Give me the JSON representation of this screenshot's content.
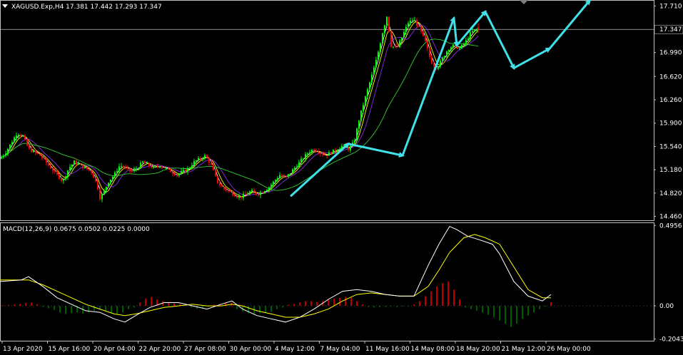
{
  "header": {
    "symbol_line": "XAGUSD.Exp,H4  17.381 17.442 17.293 17.347",
    "macd_line": "MACD(12,26,9) 0.0675 0.0502 0.0225 0.0000"
  },
  "colors": {
    "background": "#000000",
    "frame": "#c0c0c0",
    "bull": "#00ff00",
    "bear": "#ff0000",
    "ma_fast": "#ffff00",
    "ma_mid": "#ffffff",
    "ma_slow": "#8a2be2",
    "ma_long": "#32cd32",
    "arrows": "#40e0e8",
    "macd_line": "#ffffff",
    "signal_line": "#ffff00",
    "hist_up": "#ff0000",
    "hist_down": "#008000"
  },
  "chart_data": [
    {
      "type": "candlestick",
      "panel": "price",
      "symbol": "XAGUSD.Exp",
      "timeframe": "H4",
      "ohlc_last": {
        "open": 17.381,
        "high": 17.442,
        "low": 17.293,
        "close": 17.347
      },
      "current_price_label": "17.347",
      "current_price": 17.347,
      "ylim": [
        14.4,
        17.79
      ],
      "y_ticks": [
        "17.710",
        "16.990",
        "16.620",
        "16.260",
        "15.900",
        "15.540",
        "15.180",
        "14.820",
        "14.460"
      ],
      "y_tick_values": [
        17.71,
        16.99,
        16.62,
        16.26,
        15.9,
        15.54,
        15.18,
        14.82,
        14.46
      ],
      "x_ticks": [
        "13 Apr 2020",
        "15 Apr 16:00",
        "20 Apr 04:00",
        "22 Apr 20:00",
        "27 Apr 08:00",
        "30 Apr 00:00",
        "4 May 12:00",
        "7 May 04:00",
        "11 May 16:00",
        "14 May 08:00",
        "18 May 20:00",
        "21 May 12:00",
        "26 May 00:00"
      ],
      "close_path": [
        [
          0,
          15.35
        ],
        [
          8,
          15.45
        ],
        [
          16,
          15.6
        ],
        [
          24,
          15.75
        ],
        [
          32,
          15.7
        ],
        [
          40,
          15.5
        ],
        [
          48,
          15.45
        ],
        [
          56,
          15.4
        ],
        [
          64,
          15.3
        ],
        [
          72,
          15.2
        ],
        [
          80,
          15.1
        ],
        [
          88,
          15.0
        ],
        [
          96,
          15.2
        ],
        [
          104,
          15.3
        ],
        [
          112,
          15.25
        ],
        [
          120,
          15.2
        ],
        [
          128,
          15.15
        ],
        [
          136,
          14.95
        ],
        [
          140,
          14.75
        ],
        [
          144,
          14.8
        ],
        [
          152,
          15.0
        ],
        [
          160,
          15.1
        ],
        [
          168,
          15.25
        ],
        [
          176,
          15.2
        ],
        [
          184,
          15.15
        ],
        [
          192,
          15.2
        ],
        [
          200,
          15.3
        ],
        [
          208,
          15.25
        ],
        [
          216,
          15.2
        ],
        [
          224,
          15.25
        ],
        [
          232,
          15.2
        ],
        [
          240,
          15.15
        ],
        [
          248,
          15.1
        ],
        [
          256,
          15.15
        ],
        [
          264,
          15.2
        ],
        [
          272,
          15.3
        ],
        [
          280,
          15.35
        ],
        [
          288,
          15.4
        ],
        [
          296,
          15.25
        ],
        [
          304,
          15.0
        ],
        [
          312,
          14.9
        ],
        [
          320,
          14.85
        ],
        [
          328,
          14.8
        ],
        [
          336,
          14.75
        ],
        [
          344,
          14.8
        ],
        [
          352,
          14.85
        ],
        [
          360,
          14.8
        ],
        [
          368,
          14.85
        ],
        [
          376,
          14.9
        ],
        [
          384,
          15.0
        ],
        [
          392,
          15.1
        ],
        [
          400,
          15.05
        ],
        [
          408,
          15.15
        ],
        [
          416,
          15.25
        ],
        [
          424,
          15.35
        ],
        [
          432,
          15.45
        ],
        [
          440,
          15.5
        ],
        [
          448,
          15.45
        ],
        [
          456,
          15.4
        ],
        [
          464,
          15.45
        ],
        [
          472,
          15.5
        ],
        [
          480,
          15.55
        ],
        [
          488,
          15.5
        ],
        [
          496,
          15.6
        ],
        [
          504,
          16.0
        ],
        [
          512,
          16.3
        ],
        [
          520,
          16.6
        ],
        [
          528,
          16.9
        ],
        [
          536,
          17.3
        ],
        [
          542,
          17.55
        ],
        [
          548,
          17.1
        ],
        [
          556,
          17.05
        ],
        [
          564,
          17.25
        ],
        [
          572,
          17.45
        ],
        [
          580,
          17.5
        ],
        [
          588,
          17.35
        ],
        [
          596,
          17.15
        ],
        [
          604,
          16.85
        ],
        [
          612,
          16.75
        ],
        [
          620,
          16.9
        ],
        [
          628,
          17.05
        ],
        [
          636,
          17.1
        ],
        [
          644,
          17.05
        ],
        [
          652,
          17.15
        ],
        [
          660,
          17.3
        ],
        [
          668,
          17.347
        ]
      ],
      "overlays": [
        {
          "name": "MA fast",
          "color_key": "ma_fast",
          "lag": 2
        },
        {
          "name": "MA mid",
          "color_key": "ma_mid",
          "lag": 1
        },
        {
          "name": "MA slow",
          "color_key": "ma_slow",
          "lag": 4
        },
        {
          "name": "MA long",
          "color_key": "ma_long",
          "lag": 14
        }
      ],
      "zigzag_arrows": [
        [
          [
            408,
            14.78
          ],
          [
            488,
            15.58
          ]
        ],
        [
          [
            488,
            15.58
          ],
          [
            564,
            15.4
          ]
        ],
        [
          [
            564,
            15.4
          ],
          [
            636,
            17.52
          ]
        ],
        [
          [
            636,
            17.52
          ],
          [
            640,
            17.1
          ]
        ],
        [
          [
            640,
            17.1
          ],
          [
            680,
            17.62
          ]
        ],
        [
          [
            680,
            17.62
          ],
          [
            720,
            16.75
          ]
        ],
        [
          [
            720,
            16.75
          ],
          [
            770,
            17.05
          ]
        ],
        [
          [
            770,
            17.05
          ],
          [
            826,
            17.79
          ]
        ]
      ]
    },
    {
      "type": "bar+line",
      "panel": "macd",
      "indicator": "MACD(12,26,9)",
      "values": {
        "macd": 0.0675,
        "signal": 0.0502,
        "histogram": 0.0225,
        "extra": 0.0
      },
      "ylim": [
        -0.215,
        0.51
      ],
      "y_ticks": [
        "0.4956",
        "0.00",
        "-0.2043"
      ],
      "y_tick_values": [
        0.4956,
        0.0,
        -0.2043
      ],
      "macd_path": [
        [
          0,
          0.15
        ],
        [
          30,
          0.16
        ],
        [
          40,
          0.18
        ],
        [
          60,
          0.12
        ],
        [
          80,
          0.05
        ],
        [
          100,
          0.01
        ],
        [
          120,
          -0.03
        ],
        [
          140,
          -0.04
        ],
        [
          160,
          -0.08
        ],
        [
          175,
          -0.1
        ],
        [
          190,
          -0.06
        ],
        [
          210,
          -0.01
        ],
        [
          230,
          0.02
        ],
        [
          250,
          0.02
        ],
        [
          270,
          0.0
        ],
        [
          290,
          -0.02
        ],
        [
          310,
          0.01
        ],
        [
          325,
          0.03
        ],
        [
          340,
          -0.02
        ],
        [
          360,
          -0.06
        ],
        [
          380,
          -0.08
        ],
        [
          400,
          -0.1
        ],
        [
          420,
          -0.07
        ],
        [
          440,
          -0.02
        ],
        [
          460,
          0.04
        ],
        [
          480,
          0.09
        ],
        [
          500,
          0.1
        ],
        [
          520,
          0.09
        ],
        [
          540,
          0.07
        ],
        [
          560,
          0.06
        ],
        [
          580,
          0.06
        ],
        [
          600,
          0.25
        ],
        [
          615,
          0.38
        ],
        [
          630,
          0.49
        ],
        [
          640,
          0.47
        ],
        [
          655,
          0.43
        ],
        [
          670,
          0.41
        ],
        [
          690,
          0.38
        ],
        [
          700,
          0.32
        ],
        [
          720,
          0.15
        ],
        [
          740,
          0.06
        ],
        [
          760,
          0.03
        ],
        [
          772,
          0.07
        ]
      ],
      "signal_path": [
        [
          0,
          0.16
        ],
        [
          40,
          0.16
        ],
        [
          60,
          0.13
        ],
        [
          80,
          0.09
        ],
        [
          100,
          0.05
        ],
        [
          120,
          0.01
        ],
        [
          140,
          -0.02
        ],
        [
          160,
          -0.05
        ],
        [
          175,
          -0.06
        ],
        [
          190,
          -0.05
        ],
        [
          210,
          -0.03
        ],
        [
          230,
          -0.01
        ],
        [
          250,
          0.0
        ],
        [
          270,
          0.01
        ],
        [
          290,
          0.0
        ],
        [
          310,
          0.0
        ],
        [
          325,
          0.01
        ],
        [
          340,
          0.0
        ],
        [
          360,
          -0.03
        ],
        [
          380,
          -0.05
        ],
        [
          400,
          -0.07
        ],
        [
          420,
          -0.07
        ],
        [
          440,
          -0.05
        ],
        [
          460,
          -0.02
        ],
        [
          480,
          0.03
        ],
        [
          500,
          0.07
        ],
        [
          520,
          0.08
        ],
        [
          540,
          0.07
        ],
        [
          560,
          0.06
        ],
        [
          580,
          0.06
        ],
        [
          600,
          0.12
        ],
        [
          615,
          0.22
        ],
        [
          630,
          0.33
        ],
        [
          650,
          0.42
        ],
        [
          665,
          0.44
        ],
        [
          680,
          0.42
        ],
        [
          700,
          0.38
        ],
        [
          720,
          0.24
        ],
        [
          740,
          0.1
        ],
        [
          760,
          0.05
        ],
        [
          772,
          0.05
        ]
      ],
      "histogram": [
        [
          4,
          0.004
        ],
        [
          12,
          0.006
        ],
        [
          20,
          0.008
        ],
        [
          28,
          0.012
        ],
        [
          36,
          0.018
        ],
        [
          44,
          0.02
        ],
        [
          52,
          0.01
        ],
        [
          60,
          -0.006
        ],
        [
          68,
          -0.015
        ],
        [
          76,
          -0.025
        ],
        [
          84,
          -0.04
        ],
        [
          92,
          -0.05
        ],
        [
          100,
          -0.045
        ],
        [
          108,
          -0.04
        ],
        [
          116,
          -0.048
        ],
        [
          124,
          -0.04
        ],
        [
          132,
          -0.03
        ],
        [
          140,
          -0.025
        ],
        [
          148,
          -0.035
        ],
        [
          156,
          -0.045
        ],
        [
          164,
          -0.05
        ],
        [
          172,
          -0.04
        ],
        [
          180,
          -0.02
        ],
        [
          188,
          -0.01
        ],
        [
          196,
          0.02
        ],
        [
          204,
          0.045
        ],
        [
          212,
          0.055
        ],
        [
          220,
          0.04
        ],
        [
          228,
          0.03
        ],
        [
          236,
          0.025
        ],
        [
          244,
          0.015
        ],
        [
          252,
          0.01
        ],
        [
          260,
          0.006
        ],
        [
          268,
          -0.01
        ],
        [
          276,
          -0.018
        ],
        [
          284,
          -0.012
        ],
        [
          292,
          -0.004
        ],
        [
          300,
          0.008
        ],
        [
          308,
          0.012
        ],
        [
          316,
          0.018
        ],
        [
          324,
          0.02
        ],
        [
          332,
          -0.02
        ],
        [
          340,
          -0.035
        ],
        [
          348,
          -0.045
        ],
        [
          356,
          -0.05
        ],
        [
          364,
          -0.045
        ],
        [
          372,
          -0.04
        ],
        [
          380,
          -0.035
        ],
        [
          388,
          -0.02
        ],
        [
          396,
          -0.01
        ],
        [
          404,
          0.006
        ],
        [
          412,
          0.012
        ],
        [
          420,
          0.02
        ],
        [
          428,
          0.03
        ],
        [
          436,
          0.03
        ],
        [
          444,
          0.025
        ],
        [
          452,
          0.03
        ],
        [
          460,
          0.035
        ],
        [
          468,
          0.045
        ],
        [
          476,
          0.05
        ],
        [
          484,
          0.055
        ],
        [
          492,
          0.05
        ],
        [
          500,
          0.03
        ],
        [
          508,
          0.01
        ],
        [
          516,
          -0.006
        ],
        [
          524,
          -0.01
        ],
        [
          532,
          -0.008
        ],
        [
          540,
          -0.006
        ],
        [
          548,
          -0.004
        ],
        [
          556,
          -0.006
        ],
        [
          564,
          -0.004
        ],
        [
          572,
          -0.004
        ],
        [
          580,
          0.01
        ],
        [
          588,
          0.03
        ],
        [
          596,
          0.06
        ],
        [
          604,
          0.09
        ],
        [
          612,
          0.12
        ],
        [
          620,
          0.14
        ],
        [
          628,
          0.15
        ],
        [
          636,
          0.1
        ],
        [
          644,
          0.04
        ],
        [
          652,
          -0.01
        ],
        [
          660,
          -0.02
        ],
        [
          668,
          -0.03
        ],
        [
          676,
          -0.04
        ],
        [
          684,
          -0.055
        ],
        [
          692,
          -0.07
        ],
        [
          700,
          -0.09
        ],
        [
          708,
          -0.11
        ],
        [
          716,
          -0.13
        ],
        [
          724,
          -0.11
        ],
        [
          732,
          -0.08
        ],
        [
          740,
          -0.06
        ],
        [
          748,
          -0.04
        ],
        [
          756,
          -0.02
        ],
        [
          764,
          -0.005
        ],
        [
          772,
          0.0225
        ]
      ]
    }
  ]
}
